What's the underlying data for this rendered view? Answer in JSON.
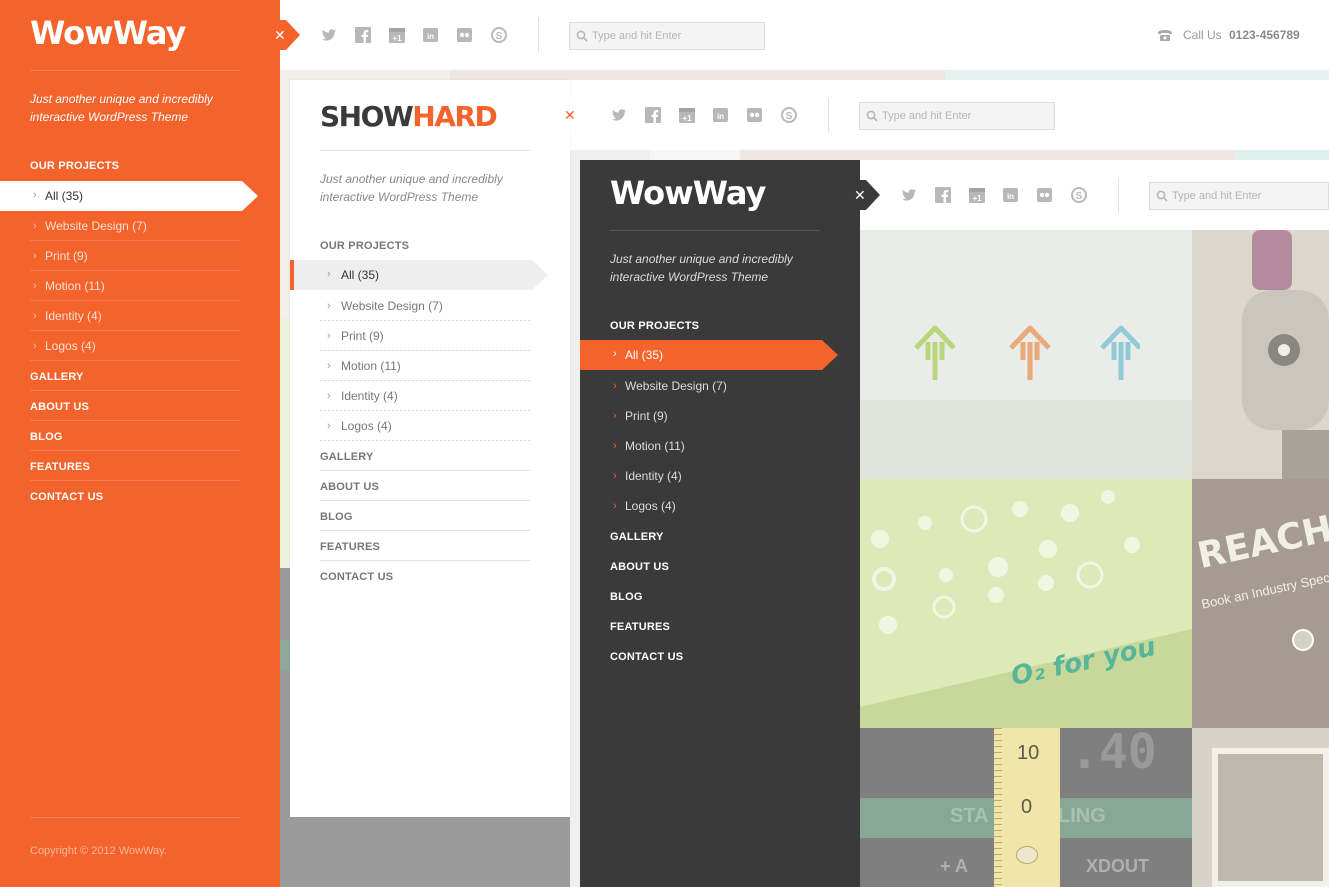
{
  "colors": {
    "accent": "#f3632b",
    "dark": "#3a3a3a",
    "light": "#ffffff"
  },
  "header": {
    "social_icons": [
      "twitter-icon",
      "facebook-icon",
      "google-plus-icon",
      "linkedin-icon",
      "flickr-icon",
      "skype-icon"
    ],
    "search_placeholder": "Type and hit Enter",
    "call_label": "Call Us",
    "phone": "0123-456789"
  },
  "theme1": {
    "logo": "WowWay",
    "tagline_line1": "Just another unique and incredibly",
    "tagline_line2": "interactive WordPress Theme",
    "projects_heading": "OUR PROJECTS",
    "subitems": [
      "All (35)",
      "Website Design (7)",
      "Print (9)",
      "Motion (11)",
      "Identity (4)",
      "Logos (4)"
    ],
    "menu": [
      "GALLERY",
      "ABOUT US",
      "BLOG",
      "FEATURES",
      "CONTACT US"
    ],
    "copyright": "Copyright © 2012 WowWay."
  },
  "theme2": {
    "logo_part1": "SHOW",
    "logo_part2": "HARD",
    "tagline_line1": "Just another unique and incredibly",
    "tagline_line2": "interactive WordPress Theme",
    "projects_heading": "OUR PROJECTS",
    "subitems": [
      "All (35)",
      "Website Design (7)",
      "Print (9)",
      "Motion (11)",
      "Identity (4)",
      "Logos (4)"
    ],
    "menu": [
      "GALLERY",
      "ABOUT US",
      "BLOG",
      "FEATURES",
      "CONTACT US"
    ]
  },
  "theme3": {
    "logo": "WowWay",
    "tagline_line1": "Just another unique and incredibly",
    "tagline_line2": "interactive WordPress Theme",
    "projects_heading": "OUR PROJECTS",
    "subitems": [
      "All (35)",
      "Website Design (7)",
      "Print (9)",
      "Motion (11)",
      "Identity (4)",
      "Logos (4)"
    ],
    "menu": [
      "GALLERY",
      "ABOUT US",
      "BLOG",
      "FEATURES",
      "CONTACT US"
    ]
  },
  "gallery": {
    "o2_text": "O₂ for you",
    "reach_text": "REACH YO",
    "reach_sub": "Book an Industry Speci",
    "ruler_top": "10",
    "ruler_bottom": "0",
    "timer_text": ".40",
    "sta_text": "STA",
    "ling_text": "LING",
    "xdout_text": "XDOUT",
    "plus_a_text": "+ A"
  }
}
